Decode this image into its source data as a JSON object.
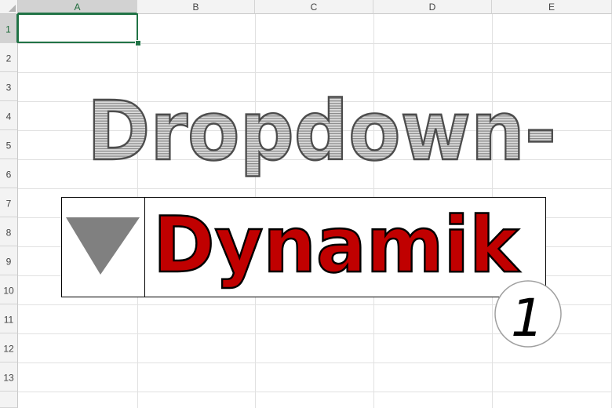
{
  "spreadsheet": {
    "columns": [
      "A",
      "B",
      "C",
      "D",
      "E"
    ],
    "rows": [
      "1",
      "2",
      "3",
      "4",
      "5",
      "6",
      "7",
      "8",
      "9",
      "10",
      "11",
      "12",
      "13"
    ],
    "selected_cell": "A1",
    "accent_color": "#217346"
  },
  "graphic": {
    "title_line1": "Dropdown-",
    "title_line2": "Dynamik",
    "title_line2_color": "#c00000",
    "badge_number": "1",
    "dropdown_icon": "triangle-down-icon"
  }
}
